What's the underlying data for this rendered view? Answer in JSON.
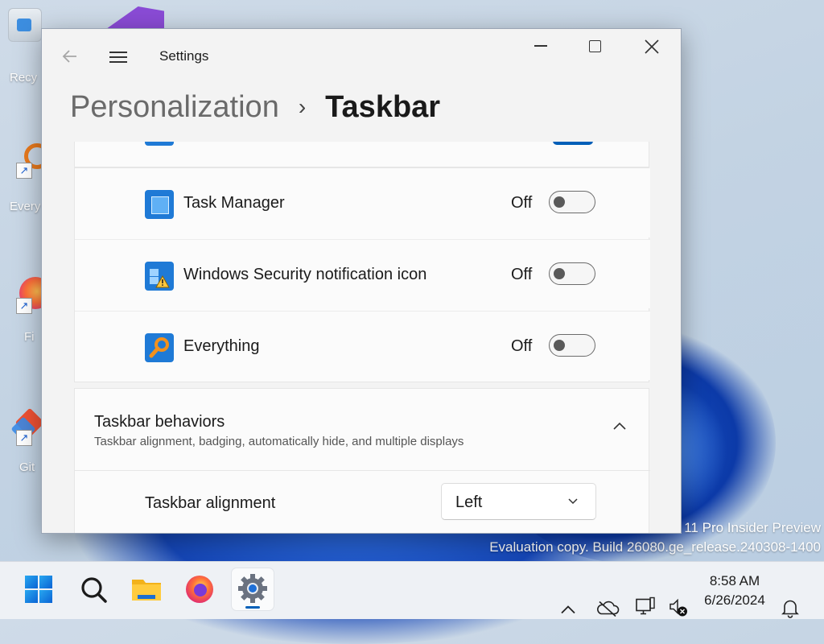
{
  "desktop": {
    "icons": [
      {
        "label": "Recy",
        "icon": "recycle-bin-icon"
      },
      {
        "label": "Every",
        "icon": "everything-icon"
      },
      {
        "label": "Fi",
        "icon": "firefox-icon"
      },
      {
        "label": "Git",
        "icon": "git-icon"
      }
    ],
    "watermark_line1": "11 Pro Insider Preview",
    "watermark_line2": "Evaluation copy. Build 26080.ge_release.240308-1400"
  },
  "window": {
    "title": "Settings",
    "breadcrumb": {
      "parent": "Personalization",
      "separator": "›",
      "current": "Taskbar"
    }
  },
  "tray_icons_list": [
    {
      "name": "Task Manager",
      "state": "Off",
      "icon": "task-manager-icon",
      "color": "#1f7ad6"
    },
    {
      "name": "Windows Security notification icon",
      "state": "Off",
      "icon": "windows-security-icon",
      "color": "#1f7ad6"
    },
    {
      "name": "Everything",
      "state": "Off",
      "icon": "everything-icon",
      "color": "#1f7ad6"
    }
  ],
  "taskbar_behaviors": {
    "title": "Taskbar behaviors",
    "subtitle": "Taskbar alignment, badging, automatically hide, and multiple displays",
    "alignment_label": "Taskbar alignment",
    "alignment_value": "Left"
  },
  "taskbar": {
    "apps": [
      "start-icon",
      "search-icon",
      "file-explorer-icon",
      "firefox-icon",
      "settings-icon"
    ],
    "clock_time": "8:58 AM",
    "clock_date": "6/26/2024"
  },
  "colors": {
    "accent": "#005fb8",
    "wallpaper_blue": "#1546b6"
  }
}
